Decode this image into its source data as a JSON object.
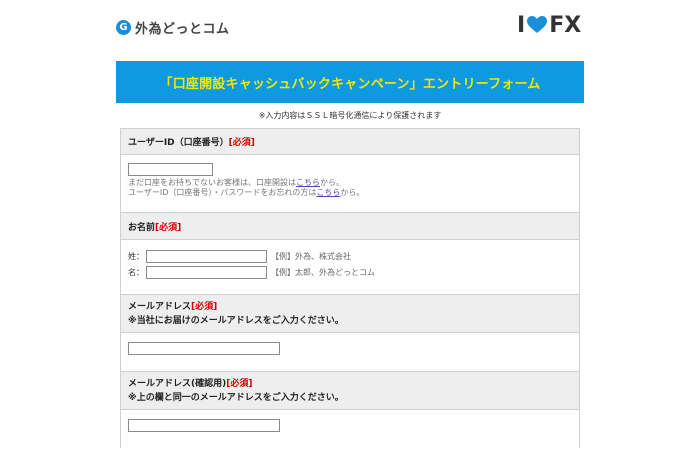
{
  "header": {
    "logo_mark": "G",
    "logo_text": "外為どっとコム",
    "right_logo_i": "I",
    "right_logo_fx": "FX"
  },
  "banner": {
    "title": "「口座開設キャッシュバックキャンペーン」エントリーフォーム"
  },
  "note": "※入力内容はＳＳＬ暗号化通信により保護されます",
  "colors": {
    "banner_bg": "#0f9ae0",
    "banner_text": "#f5e600",
    "required": "#d40000",
    "heart": "#1a8fd8"
  },
  "sections": {
    "user_id": {
      "label": "ユーザーID（口座番号）",
      "required": "[必須]",
      "help1_before": "まだ口座をお持ちでないお客様は、口座開設は",
      "help1_link": "こちら",
      "help1_after": "から。",
      "help2_before": "ユーザーID（口座番号）・パスワードをお忘れの方は",
      "help2_link": "こちら",
      "help2_after": "から。",
      "value": ""
    },
    "name": {
      "label": "お名前",
      "required": "[必須]",
      "last_label": "姓：",
      "last_example": "【例】外為、株式会社",
      "first_label": "名：",
      "first_example": "【例】太郎、外為どっとコム"
    },
    "email": {
      "label": "メールアドレス",
      "required": "[必須]",
      "note": "※当社にお届けのメールアドレスをご入力ください。"
    },
    "email_confirm": {
      "label": "メールアドレス(確認用)",
      "required": "[必須]",
      "note": "※上の欄と同一のメールアドレスをご入力ください。"
    }
  }
}
